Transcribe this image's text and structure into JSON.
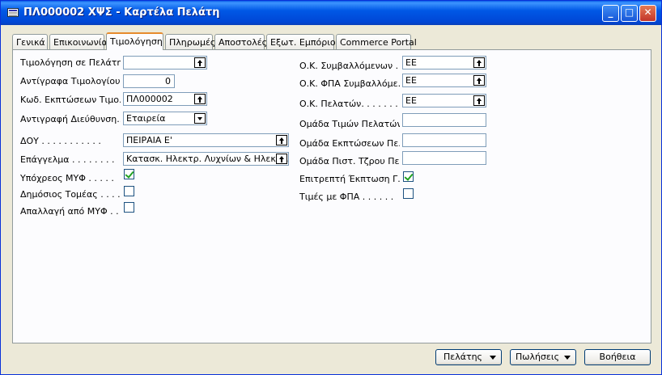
{
  "window": {
    "title": "ΠΛ000002 ΧΨΣ - Καρτέλα Πελάτη",
    "controls": {
      "minimize": "_",
      "maximize": "□",
      "close": "✕"
    }
  },
  "tabs": [
    {
      "label": "Γενικά",
      "active": false
    },
    {
      "label": "Επικοινωνία",
      "active": false
    },
    {
      "label": "Τιμολόγηση",
      "active": true
    },
    {
      "label": "Πληρωμές",
      "active": false
    },
    {
      "label": "Αποστολές",
      "active": false
    },
    {
      "label": "Εξωτ. Εμπόριο",
      "active": false
    },
    {
      "label": "Commerce Portal",
      "active": false
    }
  ],
  "left_fields": [
    {
      "label": "Τιμολόγηση σε Πελάτη...",
      "value": "",
      "control": "lookup"
    },
    {
      "label": "Αντίγραφα Τιμολογίου. .",
      "value": "0",
      "control": "number"
    },
    {
      "label": "Κωδ. Εκπτώσεων Τιμο...",
      "value": "ΠΛ000002",
      "control": "lookup"
    },
    {
      "label": "Αντιγραφή Διεύθυνση...",
      "value": "Εταιρεία",
      "control": "dropdown"
    },
    {
      "label": "ΔΟΥ . . . . . . . . . . .",
      "value": "ΠΕΙΡΑΙΑ Ε'",
      "control": "lookup"
    },
    {
      "label": "Επάγγελμα . . . . . . . .",
      "value": "Κατασκ. Ηλεκτρ. Λυχνίων & Ηλεκτ...",
      "control": "lookup"
    }
  ],
  "left_checks": [
    {
      "label": "Υπόχρεος ΜΥΦ . . . . .",
      "checked": true
    },
    {
      "label": "Δημόσιος Τομέας . . . .",
      "checked": false
    },
    {
      "label": "Απαλλαγή από ΜΥΦ . . .",
      "checked": false
    }
  ],
  "right_fields": [
    {
      "label": "Ο.Κ. Συμβαλλόμενων . .",
      "value": "ΕΕ"
    },
    {
      "label": "Ο.Κ. ΦΠΑ Συμβαλλόμε...",
      "value": "ΕΕ"
    },
    {
      "label": "Ο.Κ. Πελατών. . . . . . .",
      "value": "ΕΕ"
    },
    {
      "label": "Ομάδα Τιμών Πελατών",
      "value": ""
    },
    {
      "label": "Ομάδα Εκπτώσεων Πε...",
      "value": ""
    },
    {
      "label": "Ομάδα Πιστ. Τζρου Πε...",
      "value": ""
    }
  ],
  "right_checks": [
    {
      "label": "Επιτρεπτή Έκπτωση Γ...",
      "checked": true
    },
    {
      "label": "Τιμές με ΦΠΑ . . . . . .",
      "checked": false
    }
  ],
  "buttons": [
    {
      "label": "Πελάτης",
      "dropdown": true
    },
    {
      "label": "Πωλήσεις",
      "dropdown": true
    },
    {
      "label": "Βοήθεια",
      "dropdown": false
    }
  ],
  "colors": {
    "title_bar": "#0058e6",
    "active_tab_highlight": "#e68b2c",
    "checkmark": "#21a121"
  }
}
